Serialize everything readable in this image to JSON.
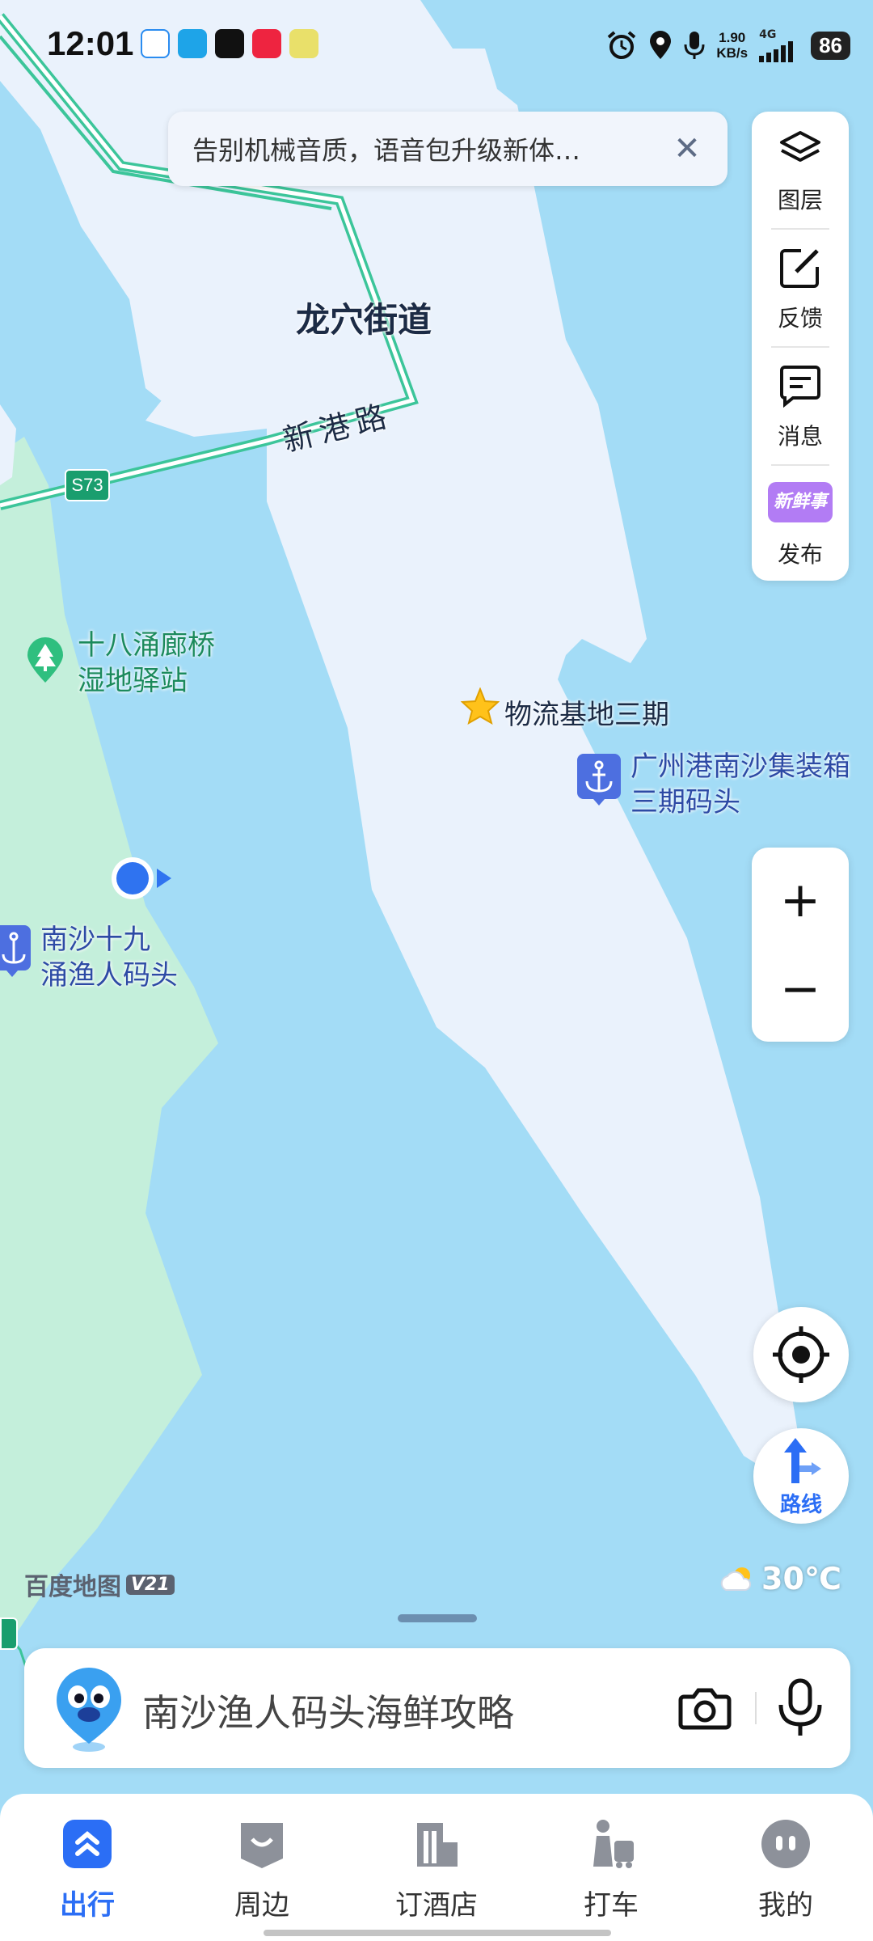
{
  "status_bar": {
    "time": "12:01",
    "net_speed_value": "1.90",
    "net_speed_unit": "KB/s",
    "network": "4G",
    "battery": "86"
  },
  "banner": {
    "text": "告别机械音质，语音包升级新体…"
  },
  "side_panel": {
    "items": [
      {
        "label": "图层",
        "icon": "layers-icon"
      },
      {
        "label": "反馈",
        "icon": "feedback-edit-icon"
      },
      {
        "label": "消息",
        "icon": "message-icon"
      },
      {
        "label": "发布",
        "icon": "xinxianshi-badge-icon",
        "badge_text": "新鲜事"
      }
    ]
  },
  "map": {
    "labels": {
      "district": "龙穴街道",
      "road": "新港路",
      "highway_shield": "S73",
      "park_line1": "十八涌廊桥",
      "park_line2": "湿地驿站",
      "favorite": "物流基地三期",
      "port_line1": "广州港南沙集装箱",
      "port_line2": "三期码头",
      "pier_line1": "南沙十九",
      "pier_line2": "涌渔人码头"
    },
    "colors": {
      "water": "#a3dcf6",
      "land": "#eaf2fc",
      "park": "#c4efdb",
      "road": "#3cc59a",
      "accent": "#2b6ef5"
    }
  },
  "zoom": {
    "in": "+",
    "out": "−"
  },
  "route_button": {
    "label": "路线"
  },
  "branding": {
    "name": "百度地图",
    "version": "V21"
  },
  "weather": {
    "temperature": "30℃",
    "icon": "partly-cloudy-icon"
  },
  "search": {
    "placeholder": "南沙渔人码头海鲜攻略"
  },
  "tabs": [
    {
      "label": "出行",
      "active": true,
      "icon": "travel-icon"
    },
    {
      "label": "周边",
      "active": false,
      "icon": "nearby-icon"
    },
    {
      "label": "订酒店",
      "active": false,
      "icon": "hotel-icon"
    },
    {
      "label": "打车",
      "active": false,
      "icon": "taxi-icon"
    },
    {
      "label": "我的",
      "active": false,
      "icon": "profile-icon"
    }
  ]
}
